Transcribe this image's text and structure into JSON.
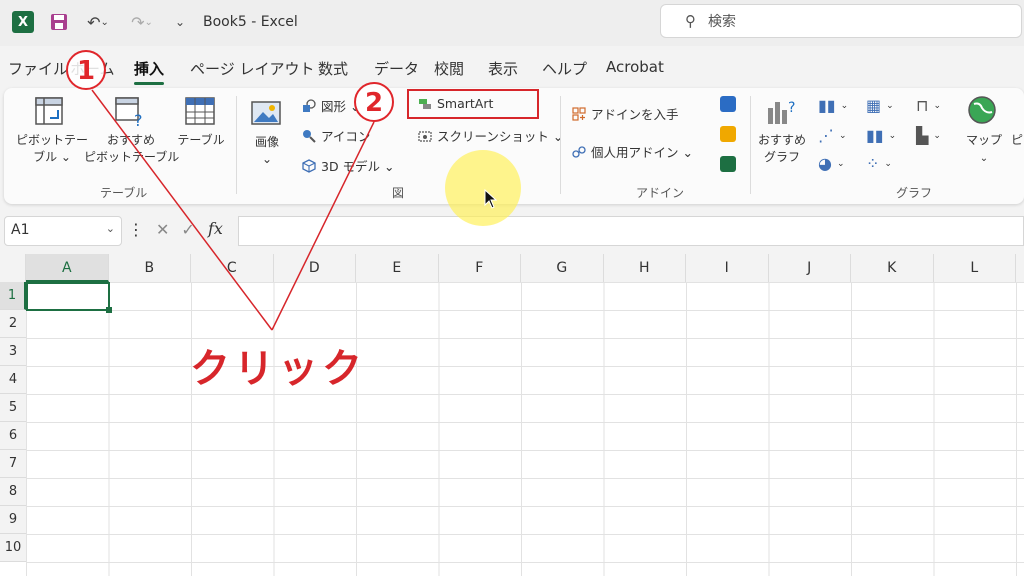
{
  "titlebar": {
    "app_icon": "X",
    "title": "Book5  -  Excel",
    "search_placeholder": "検索"
  },
  "tabs": [
    "ファイル",
    "ホーム",
    "挿入",
    "ページ レイアウト",
    "数式",
    "データ",
    "校閲",
    "表示",
    "ヘルプ",
    "Acrobat"
  ],
  "active_tab": "挿入",
  "ribbon": {
    "table_group": {
      "label": "テーブル",
      "pivot_line1": "ピボットテー",
      "pivot_line2": "ブル ⌄",
      "recommended_line1": "おすすめ",
      "recommended_line2": "ピボットテーブル",
      "table": "テーブル"
    },
    "illustrations_group": {
      "label": "図",
      "image": "画像",
      "image_dd": "⌄",
      "shapes": "図形 ⌄",
      "icons": "アイコン",
      "models3d": "3D モデル  ⌄",
      "smartart": "SmartArt",
      "screenshot": "スクリーンショット ⌄"
    },
    "addins_group": {
      "label": "アドイン",
      "get_addins": "アドインを入手",
      "my_addins": "個人用アドイン  ⌄"
    },
    "charts_group": {
      "label": "グラフ",
      "recommended_line1": "おすすめ",
      "recommended_line2": "グラフ",
      "map": "マップ",
      "pivot_chart_partial": "ピ"
    }
  },
  "formula_bar": {
    "name_box": "A1",
    "cancel": "✕",
    "enter": "✓",
    "fx": "fx"
  },
  "grid": {
    "columns": [
      "A",
      "B",
      "C",
      "D",
      "E",
      "F",
      "G",
      "H",
      "I",
      "J",
      "K",
      "L"
    ],
    "rows": [
      "1",
      "2",
      "3",
      "4",
      "5",
      "6",
      "7",
      "8",
      "9",
      "10"
    ],
    "active_cell": "A1"
  },
  "annotations": {
    "step1": "1",
    "step2": "2",
    "click_text": "クリック"
  },
  "colors": {
    "excel_green": "#1d6f42",
    "annotation_red": "#d7262b",
    "cursor_highlight": "#fff050"
  }
}
